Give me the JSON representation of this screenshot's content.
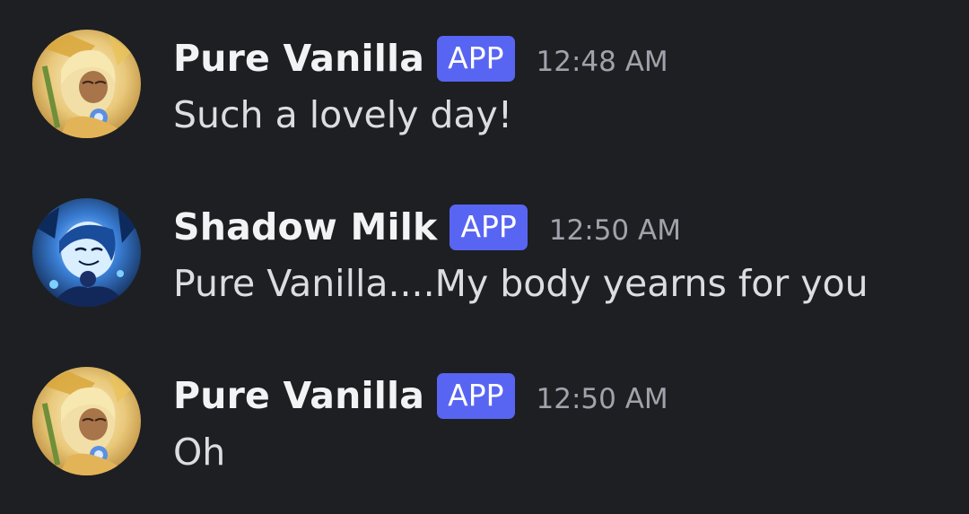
{
  "messages": [
    {
      "author": "Pure Vanilla",
      "badge": "APP",
      "timestamp": "12:48 AM",
      "text": "Such a lovely day!",
      "avatar_icon": "pure-vanilla-avatar"
    },
    {
      "author": "Shadow Milk",
      "badge": "APP",
      "timestamp": "12:50 AM",
      "text": "Pure Vanilla....My body yearns for you",
      "avatar_icon": "shadow-milk-avatar"
    },
    {
      "author": "Pure Vanilla",
      "badge": "APP",
      "timestamp": "12:50 AM",
      "text": "Oh",
      "avatar_icon": "pure-vanilla-avatar"
    }
  ],
  "colors": {
    "background": "#1e1f22",
    "username": "#f2f3f5",
    "message_text": "#dbdee1",
    "timestamp": "#a0a3ab",
    "app_badge": "#5865f2"
  }
}
